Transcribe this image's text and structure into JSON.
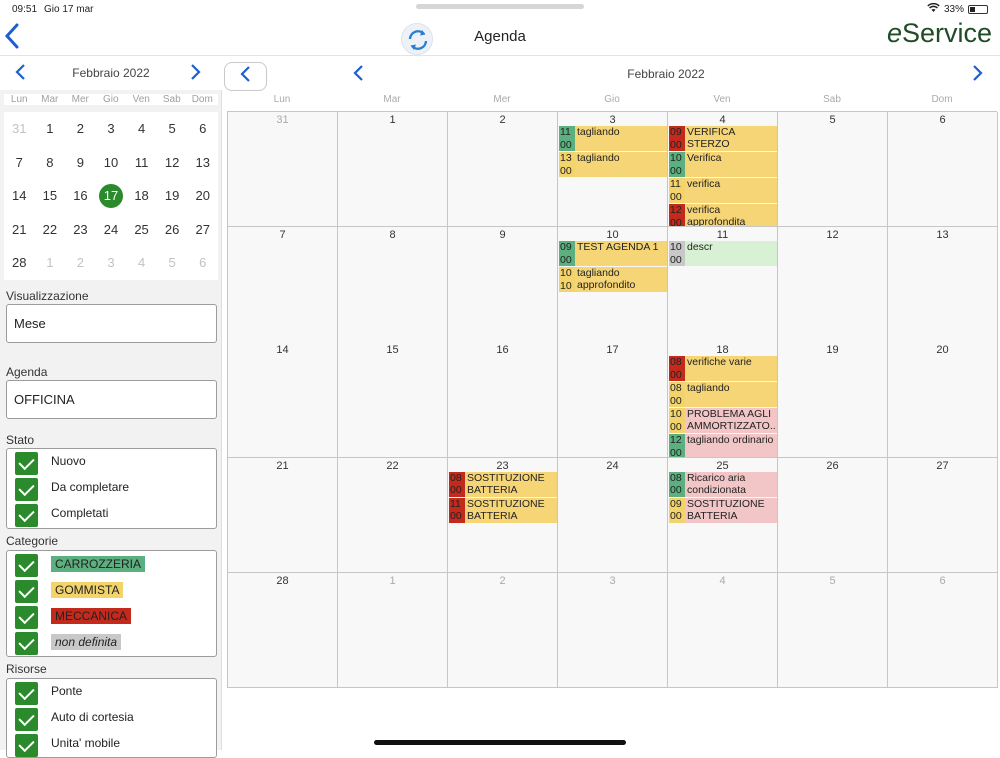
{
  "status": {
    "time": "09:51",
    "date": "Gio 17 mar",
    "battery": "33%"
  },
  "nav": {
    "title": "Agenda",
    "logo_e": "e",
    "logo_rest": "Service"
  },
  "colors": {
    "green": "#5cb07f",
    "yellow": "#f3d36b",
    "red": "#c42a1c",
    "grey": "#c8c8c8",
    "ev_yellow": "#f5d576",
    "ev_pink": "#f2c6c6",
    "ev_lightgreen": "#d8f1d4",
    "today": "#2b8a2b"
  },
  "mini": {
    "title": "Febbraio 2022",
    "dow": [
      "Lun",
      "Mar",
      "Mer",
      "Gio",
      "Ven",
      "Sab",
      "Dom"
    ],
    "days": [
      {
        "d": "31",
        "o": true
      },
      {
        "d": "1"
      },
      {
        "d": "2"
      },
      {
        "d": "3"
      },
      {
        "d": "4"
      },
      {
        "d": "5"
      },
      {
        "d": "6"
      },
      {
        "d": "7"
      },
      {
        "d": "8"
      },
      {
        "d": "9"
      },
      {
        "d": "10"
      },
      {
        "d": "11"
      },
      {
        "d": "12"
      },
      {
        "d": "13"
      },
      {
        "d": "14"
      },
      {
        "d": "15"
      },
      {
        "d": "16"
      },
      {
        "d": "17",
        "t": true
      },
      {
        "d": "18"
      },
      {
        "d": "19"
      },
      {
        "d": "20"
      },
      {
        "d": "21"
      },
      {
        "d": "22"
      },
      {
        "d": "23"
      },
      {
        "d": "24"
      },
      {
        "d": "25"
      },
      {
        "d": "26"
      },
      {
        "d": "27"
      },
      {
        "d": "28"
      },
      {
        "d": "1",
        "o": true
      },
      {
        "d": "2",
        "o": true
      },
      {
        "d": "3",
        "o": true
      },
      {
        "d": "4",
        "o": true
      },
      {
        "d": "5",
        "o": true
      },
      {
        "d": "6",
        "o": true
      }
    ]
  },
  "filters": {
    "view_label": "Visualizzazione",
    "view_value": "Mese",
    "agenda_label": "Agenda",
    "agenda_value": "OFFICINA",
    "stato_label": "Stato",
    "stato": [
      "Nuovo",
      "Da completare",
      "Completati"
    ],
    "categorie_label": "Categorie",
    "categorie": [
      {
        "name": "CARROZZERIA",
        "color": "#5cb07f",
        "italic": false
      },
      {
        "name": "GOMMISTA",
        "color": "#f3d36b",
        "italic": false
      },
      {
        "name": "MECCANICA",
        "color": "#c42a1c",
        "italic": false
      },
      {
        "name": "non definita",
        "color": "#c8c8c8",
        "italic": true
      }
    ],
    "risorse_label": "Risorse",
    "risorse": [
      "Ponte",
      "Auto di cortesia",
      "Unita' mobile"
    ]
  },
  "calendar": {
    "title": "Febbraio 2022",
    "dow": [
      "Lun",
      "Mar",
      "Mer",
      "Gio",
      "Ven",
      "Sab",
      "Dom"
    ],
    "days": [
      {
        "d": "31",
        "o": true
      },
      {
        "d": "1"
      },
      {
        "d": "2"
      },
      {
        "d": "3",
        "ev": [
          {
            "t1": "11",
            "t2": "00",
            "txt": "tagliando",
            "tc": "#5cb07f",
            "bg": "#f5d576"
          },
          {
            "t1": "13",
            "t2": "00",
            "txt": "tagliando",
            "tc": "#f3d36b",
            "bg": "#f5d576"
          }
        ]
      },
      {
        "d": "4",
        "ev": [
          {
            "t1": "09",
            "t2": "00",
            "txt": "VERIFICA STERZO",
            "tc": "#c42a1c",
            "bg": "#f5d576"
          },
          {
            "t1": "10",
            "t2": "00",
            "txt": "Verifica",
            "tc": "#5cb07f",
            "bg": "#f5d576"
          },
          {
            "t1": "11",
            "t2": "00",
            "txt": "verifica",
            "tc": "#f3d36b",
            "bg": "#f5d576"
          },
          {
            "t1": "12",
            "t2": "00",
            "txt": "verifica approfondita",
            "tc": "#c42a1c",
            "bg": "#f5d576"
          }
        ]
      },
      {
        "d": "5"
      },
      {
        "d": "6"
      },
      {
        "d": "7"
      },
      {
        "d": "8"
      },
      {
        "d": "9"
      },
      {
        "d": "10",
        "ev": [
          {
            "t1": "09",
            "t2": "00",
            "txt": "TEST AGENDA 1",
            "tc": "#5cb07f",
            "bg": "#f5d576"
          },
          {
            "t1": "10",
            "t2": "10",
            "txt": "tagliando approfondito",
            "tc": "#f3d36b",
            "bg": "#f5d576"
          }
        ]
      },
      {
        "d": "11",
        "ev": [
          {
            "t1": "10",
            "t2": "00",
            "txt": "descr",
            "tc": "#c8c8c8",
            "bg": "#d8f1d4"
          }
        ]
      },
      {
        "d": "12"
      },
      {
        "d": "13"
      },
      {
        "d": "14"
      },
      {
        "d": "15"
      },
      {
        "d": "16"
      },
      {
        "d": "17"
      },
      {
        "d": "18",
        "ev": [
          {
            "t1": "08",
            "t2": "00",
            "txt": "verifiche varie",
            "tc": "#c42a1c",
            "bg": "#f5d576"
          },
          {
            "t1": "08",
            "t2": "00",
            "txt": "tagliando",
            "tc": "#f3d36b",
            "bg": "#f5d576"
          },
          {
            "t1": "10",
            "t2": "00",
            "txt": "PROBLEMA AGLI AMMORTIZZATO...",
            "tc": "#f3d36b",
            "bg": "#f2c6c6"
          },
          {
            "t1": "12",
            "t2": "00",
            "txt": "tagliando ordinario",
            "tc": "#5cb07f",
            "bg": "#f2c6c6"
          }
        ]
      },
      {
        "d": "19"
      },
      {
        "d": "20"
      },
      {
        "d": "21"
      },
      {
        "d": "22"
      },
      {
        "d": "23",
        "ev": [
          {
            "t1": "08",
            "t2": "00",
            "txt": "SOSTITUZIONE BATTERIA",
            "tc": "#c42a1c",
            "bg": "#f5d576"
          },
          {
            "t1": "11",
            "t2": "00",
            "txt": "SOSTITUZIONE BATTERIA",
            "tc": "#c42a1c",
            "bg": "#f5d576"
          }
        ]
      },
      {
        "d": "24"
      },
      {
        "d": "25",
        "ev": [
          {
            "t1": "08",
            "t2": "00",
            "txt": "Ricarico aria condizionata",
            "tc": "#5cb07f",
            "bg": "#f2c6c6"
          },
          {
            "t1": "09",
            "t2": "00",
            "txt": "SOSTITUZIONE BATTERIA",
            "tc": "#f3d36b",
            "bg": "#f2c6c6"
          }
        ]
      },
      {
        "d": "26"
      },
      {
        "d": "27"
      },
      {
        "d": "28"
      },
      {
        "d": "1",
        "o": true
      },
      {
        "d": "2",
        "o": true
      },
      {
        "d": "3",
        "o": true
      },
      {
        "d": "4",
        "o": true
      },
      {
        "d": "5",
        "o": true
      },
      {
        "d": "6",
        "o": true
      }
    ]
  }
}
